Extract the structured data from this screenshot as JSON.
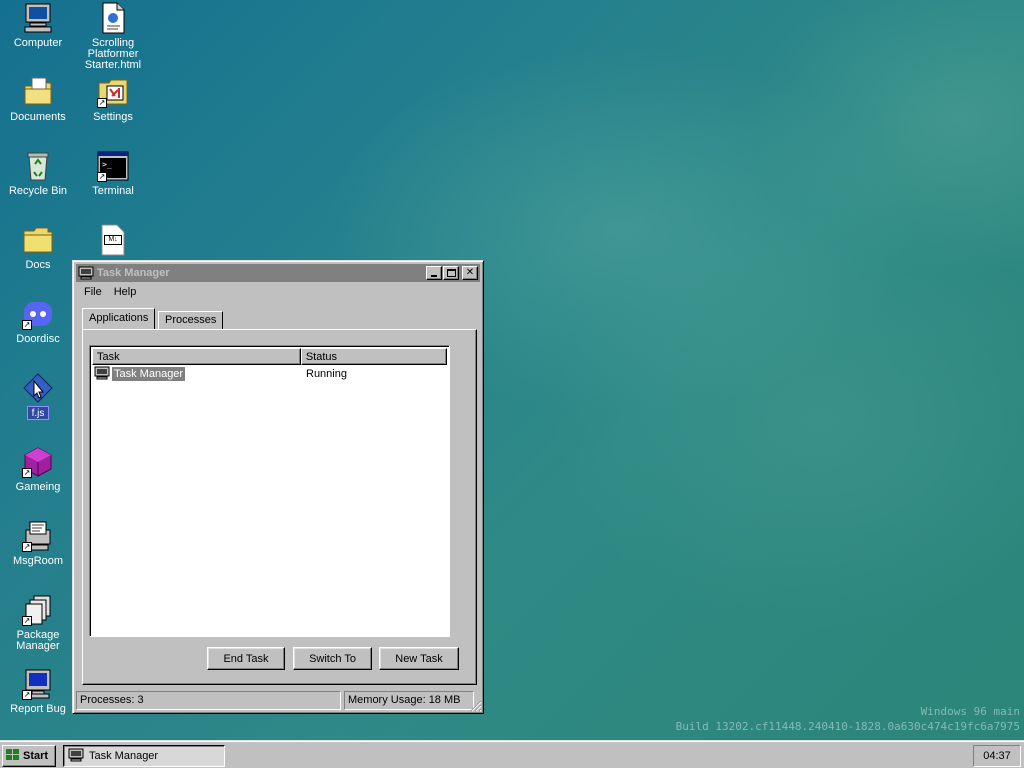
{
  "desktop": {
    "icons": [
      {
        "label": "Computer",
        "icon": "computer-icon"
      },
      {
        "label": "Scrolling Platformer Starter.html",
        "icon": "html-file-icon"
      },
      {
        "label": "Documents",
        "icon": "documents-folder-icon"
      },
      {
        "label": "Settings",
        "icon": "settings-icon"
      },
      {
        "label": "Recycle Bin",
        "icon": "recycle-bin-icon"
      },
      {
        "label": "Terminal",
        "icon": "terminal-icon"
      },
      {
        "label": "Docs",
        "icon": "folder-icon"
      },
      {
        "label": "",
        "icon": "markdown-file-icon"
      },
      {
        "label": "Doordisc",
        "icon": "doordisc-icon"
      },
      {
        "label": "",
        "icon": "fjs-icon"
      },
      {
        "label": "Gameing",
        "icon": "gameing-icon"
      },
      {
        "label": "MsgRoom",
        "icon": "msgroom-icon"
      },
      {
        "label": "Package Manager",
        "icon": "package-manager-icon"
      },
      {
        "label": "Report Bug",
        "icon": "report-bug-icon"
      }
    ],
    "fjs_badge": "f.js",
    "md_badge": "M↓",
    "watermark_line1": "Windows 96 main",
    "watermark_line2": "Build 13202.cf11448.240410-1828.0a630c474c19fc6a7975"
  },
  "window": {
    "title": "Task Manager",
    "menu": [
      "File",
      "Help"
    ],
    "tabs": [
      "Applications",
      "Processes"
    ],
    "columns": [
      "Task",
      "Status"
    ],
    "rows": [
      {
        "task": "Task Manager",
        "status": "Running"
      }
    ],
    "buttons": {
      "end_task": "End Task",
      "switch_to": "Switch To",
      "new_task": "New Task"
    },
    "status": {
      "processes": "Processes: 3",
      "memory": "Memory Usage: 18 MB"
    }
  },
  "taskbar": {
    "start_label": "Start",
    "task_label": "Task Manager",
    "clock": "04:37"
  }
}
